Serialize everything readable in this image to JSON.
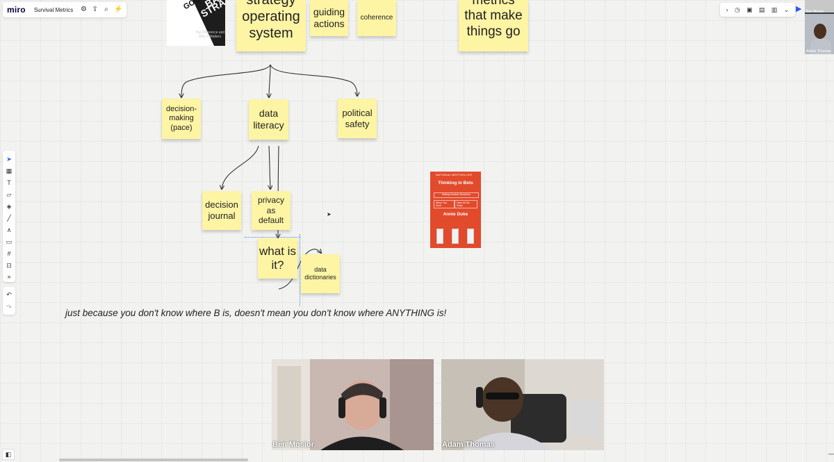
{
  "app": {
    "logo": "miro",
    "board_title": "Survival Metrics"
  },
  "topbar_icons": [
    "gear-icon",
    "upload-icon",
    "search-icon",
    "magic-icon"
  ],
  "topright_icons": [
    "chevron-right-icon",
    "timer-icon",
    "frame-icon",
    "comment-icon",
    "notes-icon",
    "chevron-down-icon"
  ],
  "participants": {
    "top_small_name": "Ben Mosior",
    "tile_name": "Adam Thomas"
  },
  "left_toolbar": [
    "select-icon",
    "template-icon",
    "text-icon",
    "sticky-note-icon",
    "shape-icon",
    "pen-icon",
    "marker-icon",
    "comment-icon",
    "frame-icon",
    "upload-icon",
    "more-icon"
  ],
  "undo_bar": [
    "undo-icon",
    "redo-icon"
  ],
  "stickies": {
    "strategy_os": "strategy operating system",
    "guiding_actions": "guiding actions",
    "coherence": "coherence",
    "metrics": "metrics that make things go",
    "decision_making": "decision-making (pace)",
    "data_literacy": "data literacy",
    "political_safety": "political safety",
    "decision_journal": "decision journal",
    "privacy_default": "privacy as default",
    "what_is_it": "what is it?",
    "data_dictionaries": "data dictionaries"
  },
  "book1": {
    "title_a": "GOOD",
    "title_b": "BAD",
    "title_c": "STRATEGY",
    "subtitle": "The Difference and Why It Matters"
  },
  "book2": {
    "badge": "NATIONAL BESTSELLER",
    "title": "Thinking in Bets",
    "subtitle": "Making Smarter Decisions",
    "box_left": "When You Don't",
    "box_right": "Have All the Facts",
    "author": "Annie Duke"
  },
  "quote": "just because you don't know where B is, doesn't mean you don't know where ANYTHING is!",
  "videos": [
    {
      "name": "Ben Mosior"
    },
    {
      "name": "Adam Thomas"
    }
  ]
}
